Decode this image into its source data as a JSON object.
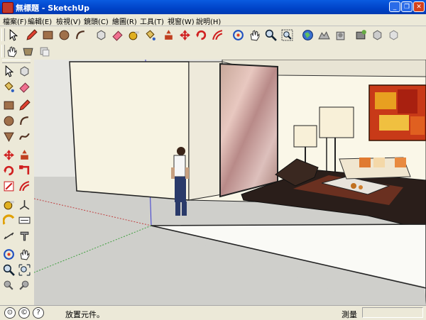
{
  "window": {
    "title": "無標題 - SketchUp",
    "min_label": "_",
    "max_label": "❐",
    "close_label": "✕"
  },
  "menu": [
    "檔案(F)",
    "編輯(E)",
    "檢視(V)",
    "鏡頭(C)",
    "繪圖(R)",
    "工具(T)",
    "視窗(W)",
    "說明(H)"
  ],
  "status": {
    "hint_text": "放置元件。",
    "measurements_label": "測量",
    "measurements_value": ""
  },
  "colors": {
    "titlebar": "#0054e3",
    "chrome": "#ece9d8",
    "ground": "#cfcfcb",
    "sky": "#e6e6e2"
  }
}
